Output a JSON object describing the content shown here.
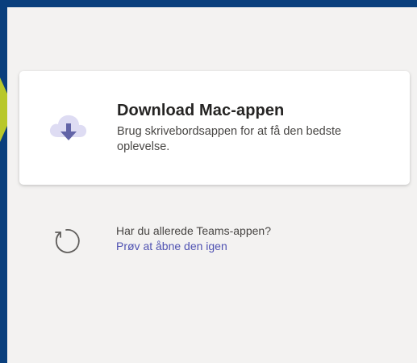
{
  "colors": {
    "frame_background": "#0a3f7d",
    "panel_background": "#f3f2f1",
    "card_background": "#ffffff",
    "accent_link": "#4f52b2",
    "icon_cloud": "#dedcf3",
    "icon_arrow": "#6264a7",
    "icon_refresh": "#605e5c",
    "side_accent": "#b8c82a"
  },
  "download_card": {
    "icon": "cloud-download-icon",
    "title": "Download Mac-appen",
    "description": "Brug skrivebordsappen for at få den bedste oplevelse."
  },
  "reopen": {
    "icon": "refresh-icon",
    "question": "Har du allerede Teams-appen?",
    "link_label": "Prøv at åbne den igen"
  }
}
